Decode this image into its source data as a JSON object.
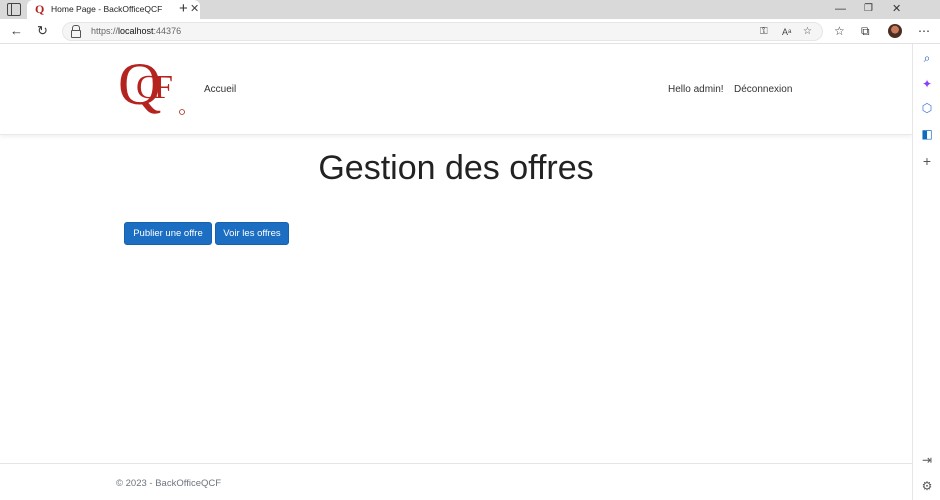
{
  "browser": {
    "tab_title": "Home Page - BackOfficeQCF",
    "tab_favicon": "Q",
    "url_prefix": "https://",
    "url_host": "localhost",
    "url_port": ":44376"
  },
  "header": {
    "logo_text": "QCF",
    "nav_home": "Accueil",
    "greeting": "Hello admin!",
    "logout": "Déconnexion"
  },
  "main": {
    "title": "Gestion des offres",
    "publish_button": "Publier une offre",
    "view_button": "Voir les offres"
  },
  "footer": {
    "copyright": "© 2023 - BackOfficeQCF"
  },
  "colors": {
    "brand_red": "#b5231f",
    "button_blue": "#1b6ec2"
  },
  "icons": [
    "sidebar-toggle-icon",
    "close-icon",
    "plus-icon",
    "minimize-icon",
    "maximize-icon",
    "back-arrow-icon",
    "refresh-icon",
    "lock-icon",
    "key-icon",
    "read-aloud-icon",
    "add-favorite-icon",
    "favorites-icon",
    "collections-icon",
    "more-icon",
    "search-icon",
    "copilot-icon",
    "office-icon",
    "outlook-icon",
    "settings-icon"
  ]
}
